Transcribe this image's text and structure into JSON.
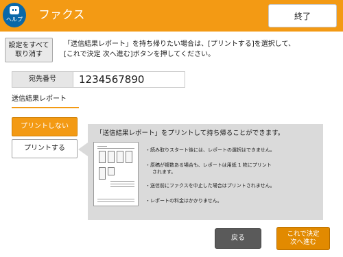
{
  "header": {
    "help_label": "ヘルプ",
    "title": "ファクス",
    "end_label": "終了",
    "accent_color": "#f39a14"
  },
  "toolbar": {
    "clear_all_line1": "設定をすべて",
    "clear_all_line2": "取り消す"
  },
  "instruction": {
    "line1": "「送信結果レポート」を持ち帰りたい場合は、[プリントする]を選択して、",
    "line2": "[これで決定 次へ進む]ボタンを押してください。"
  },
  "destination": {
    "label": "宛先番号",
    "value": "1234567890"
  },
  "section": {
    "label": "送信結果レポート"
  },
  "options": [
    {
      "label": "プリントしない",
      "selected": true
    },
    {
      "label": "プリントする",
      "selected": false
    }
  ],
  "info": {
    "heading": "「送信結果レポート」をプリントして持ち帰ることができます。",
    "notes": [
      "・読み取りスタート後には、レポートの選択はできません。",
      "・原稿が複数ある場合も、レポートは用紙 1 枚にプリント",
      "されます。",
      "・送信前にファクスを中止した場合はプリントされません。",
      "・レポートの料金はかかりません。"
    ]
  },
  "footer": {
    "back_label": "戻る",
    "next_line1": "これで決定",
    "next_line2": "次へ進む"
  },
  "icons": {
    "help": "help-face-icon"
  }
}
